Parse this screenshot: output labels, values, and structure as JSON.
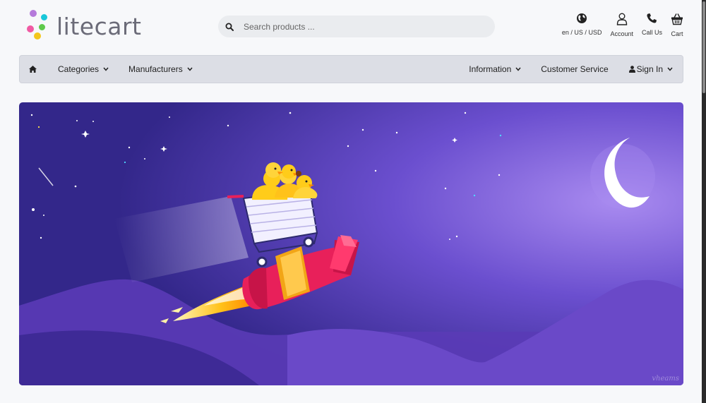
{
  "header": {
    "logo_text": "litecart",
    "logo_colors": [
      "#b57adb",
      "#19c7d9",
      "#f05aa3",
      "#5ec94b",
      "#f3c61b"
    ],
    "search": {
      "placeholder": "Search products ...",
      "value": ""
    },
    "icons": [
      {
        "icon": "globe-icon",
        "label": "en / US / USD"
      },
      {
        "icon": "user-icon",
        "label": "Account"
      },
      {
        "icon": "phone-icon",
        "label": "Call Us"
      },
      {
        "icon": "basket-icon",
        "label": "Cart"
      }
    ]
  },
  "nav": {
    "home_icon": "home-icon",
    "left": [
      {
        "label": "Categories"
      },
      {
        "label": "Manufacturers"
      }
    ],
    "right": [
      {
        "label": "Information"
      },
      {
        "label": "Customer Service"
      },
      {
        "label": "Sign In"
      }
    ]
  },
  "banner": {
    "signature": "vheams",
    "sky_color": "#3a2a8c",
    "mountain_color": "#5b3db8"
  }
}
